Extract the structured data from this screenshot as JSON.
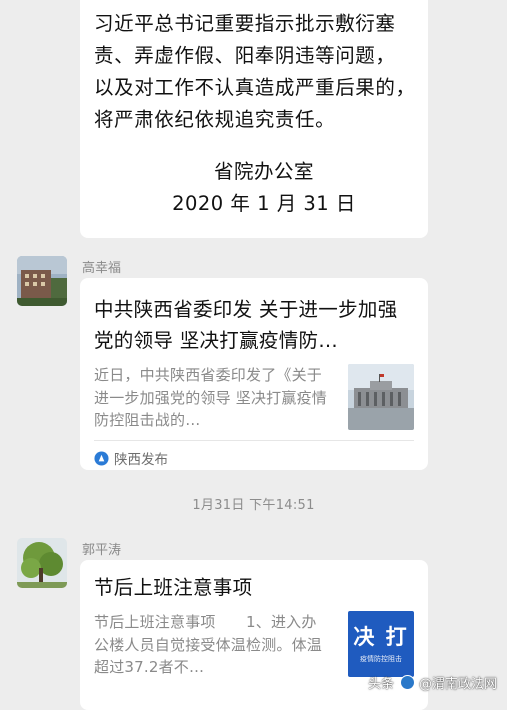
{
  "messages": [
    {
      "type": "text",
      "body": "习近平总书记重要指示批示敷衍塞\n责、弄虚作假、阳奉阴违等问题，\n以及对工作不认真造成严重后果的，\n将严肃依纪依规追究责任。",
      "signature": "省院办公室",
      "date": "2020 年 1 月 31 日"
    },
    {
      "type": "link",
      "sender": "高幸福",
      "title": "中共陕西省委印发 关于进一步加强党的领导 坚决打赢疫情防…",
      "description": "近日，中共陕西省委印发了《关于进一步加强党的领导 坚决打赢疫情防控阻击战的…",
      "source": "陕西发布"
    },
    {
      "type": "link",
      "sender": "郭平涛",
      "title": "节后上班注意事项",
      "description": "节后上班注意事项　　1、进入办公楼人员自觉接受体温检测。体温超过37.2者不…",
      "thumbnail_text": "决 打",
      "thumbnail_subtext": "疫情防控阻击"
    }
  ],
  "timestamp": "1月31日 下午14:51",
  "watermark": {
    "prefix": "头条",
    "account": "@渭南政法网"
  },
  "colors": {
    "background": "#ededed",
    "bubble": "#ffffff",
    "meta_text": "#8a8a8a"
  }
}
